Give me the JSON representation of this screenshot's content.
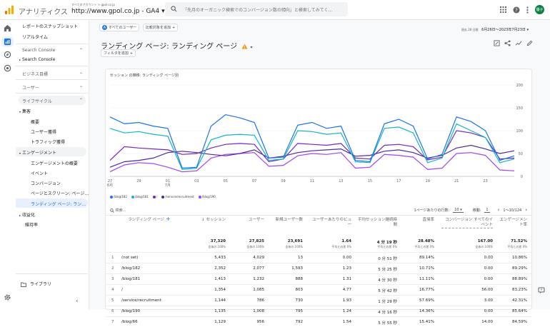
{
  "topbar": {
    "app_title": "アナリティクス",
    "account_path": "すべてのアカウント > gpol.co.jp",
    "property": "http://www.gpol.co.jp - GA4",
    "search_placeholder": "「先月のオーガニック検索でのコンバージョン数の傾向」と検索してみてく...",
    "avatar_initials": "優子"
  },
  "sidebar": {
    "snapshot": "レポートのスナップショット",
    "realtime": "リアルタイム",
    "search_console_section": "Search Console",
    "search_console_item": "Search Console",
    "business_goals": "ビジネス目標",
    "user": "ユーザー",
    "lifecycle": "ライフサイクル",
    "acquisition": "集客",
    "acq_overview": "概要",
    "acq_user": "ユーザー獲得",
    "acq_traffic": "トラフィック獲得",
    "engagement": "エンゲージメント",
    "eng_overview": "エンゲージメントの概要",
    "eng_events": "イベント",
    "eng_conversions": "コンバージョン",
    "eng_pages": "ページとスクリーン: ページ...",
    "eng_landing": "ランディング ページ: ラン...",
    "monetization": "収益化",
    "retention": "維持率",
    "library": "ライブラリ"
  },
  "filters": {
    "all_users": "すべてのユーザー",
    "add_comparison": "比較対象を追加",
    "add_filter": "フィルタを追加",
    "date_label": "過去 28 日間",
    "date_range": "6月26日～2023年7月23日"
  },
  "page": {
    "title": "ランディング ページ: ランディング ページ"
  },
  "chart_title": "セッション の推移: ランディング ページ別",
  "chart_data": {
    "type": "line",
    "ylim": [
      0,
      200
    ],
    "yticks": [
      "0",
      "50",
      "100",
      "150",
      "200"
    ],
    "x_labels": [
      "27\n6月",
      "29",
      "01\n7月",
      "03",
      "05",
      "07",
      "09",
      "11",
      "13",
      "15",
      "17",
      "19",
      "21",
      "23"
    ],
    "series": [
      {
        "name": "/blog/182",
        "color": "#1a73e8",
        "values": [
          130,
          115,
          118,
          110,
          105,
          18,
          20,
          110,
          135,
          128,
          118,
          40,
          42,
          112,
          118,
          105,
          110,
          35,
          32,
          115,
          125,
          110,
          38,
          48,
          130,
          120,
          100,
          35,
          45
        ]
      },
      {
        "name": "/blog/181",
        "color": "#12b5cb",
        "values": [
          105,
          95,
          98,
          92,
          88,
          15,
          18,
          80,
          90,
          92,
          90,
          35,
          38,
          100,
          98,
          92,
          95,
          32,
          30,
          105,
          108,
          95,
          30,
          40,
          115,
          100,
          85,
          30,
          38
        ]
      },
      {
        "name": "/",
        "color": "#7627bb",
        "values": [
          35,
          65,
          62,
          60,
          58,
          48,
          50,
          62,
          70,
          72,
          70,
          32,
          38,
          72,
          70,
          68,
          72,
          40,
          38,
          68,
          70,
          65,
          36,
          42,
          100,
          95,
          85,
          38,
          40
        ]
      },
      {
        "name": "/service/recruitment",
        "color": "#4b2a9f",
        "values": [
          20,
          32,
          35,
          40,
          52,
          55,
          52,
          48,
          45,
          50,
          58,
          40,
          44,
          52,
          56,
          58,
          60,
          44,
          46,
          55,
          58,
          52,
          40,
          46,
          62,
          68,
          60,
          50,
          56
        ]
      },
      {
        "name": "/blog/190",
        "color": "#a142f4",
        "values": [
          10,
          25,
          30,
          28,
          20,
          10,
          12,
          40,
          48,
          50,
          52,
          22,
          24,
          45,
          50,
          48,
          52,
          18,
          20,
          48,
          46,
          42,
          15,
          18,
          50,
          52,
          46,
          14,
          12
        ]
      }
    ]
  },
  "table": {
    "search_placeholder": "検索...",
    "rows_per_page_label": "1ページあたりの行数:",
    "rows_per_page": "10",
    "goto_label": "移動:",
    "goto_value": "1",
    "range": "1〜10/124",
    "headers": {
      "page": "ランディング ページ",
      "sessions": "↓ セッション",
      "users": "ユーザー",
      "new_users": "新規ユーザー数",
      "sessions_per_user": "ユーザーあたりのビュー",
      "avg_engagement": "平均セッション継続時間",
      "bounce": "直帰率",
      "conversions": "コンバージョン すべてのイベント",
      "engagement_rate": "エンゲージメント率"
    },
    "totals": {
      "sessions": "37,320",
      "sessions_sub": "全体の 100%",
      "users": "27,825",
      "users_sub": "全体の 100%",
      "new_users": "23,691",
      "new_users_sub": "全体の 100%",
      "spu": "1.64",
      "spu_sub": "平均との差 0%",
      "avg": "4 分 19 秒",
      "avg_sub": "平均との差 0%",
      "bounce": "28.48%",
      "bounce_sub": "平均との差 0%",
      "conv": "167.00",
      "conv_sub": "全体の 100%",
      "eng": "71.52%",
      "eng_sub": "平均との差 0%"
    },
    "rows": [
      {
        "n": "1",
        "page": "(not set)",
        "sessions": "5,433",
        "users": "4,029",
        "new": "13",
        "spu": "0.00",
        "avg": "0 分 51 秒",
        "bounce": "89.14%",
        "conv": "0.00",
        "eng": "10.86%"
      },
      {
        "n": "2",
        "page": "/blog/182",
        "sessions": "2,352",
        "users": "2,077",
        "new": "1,593",
        "spu": "1.23",
        "avg": "5 分 25 秒",
        "bounce": "10.71%",
        "conv": "0.00",
        "eng": "89.29%"
      },
      {
        "n": "3",
        "page": "/blog/181",
        "sessions": "1,413",
        "users": "1,232",
        "new": "888",
        "spu": "1.31",
        "avg": "4 分 30 秒",
        "bounce": "11.11%",
        "conv": "0.00",
        "eng": "88.89%"
      },
      {
        "n": "4",
        "page": "/",
        "sessions": "1,354",
        "users": "1,085",
        "new": "803",
        "spu": "4.77",
        "avg": "5 分 42 秒",
        "bounce": "16.77%",
        "conv": "56.00",
        "eng": "83.23%"
      },
      {
        "n": "5",
        "page": "/service/recruitment",
        "sessions": "1,144",
        "users": "786",
        "new": "730",
        "spu": "1.93",
        "avg": "1 分 29 秒",
        "bounce": "57.69%",
        "conv": "3.00",
        "eng": "42.31%"
      },
      {
        "n": "6",
        "page": "/blog/190",
        "sessions": "1,135",
        "users": "1,008",
        "new": "795",
        "spu": "1.24",
        "avg": "4 分 16 秒",
        "bounce": "14.36%",
        "conv": "0.00",
        "eng": "85.64%"
      },
      {
        "n": "7",
        "page": "/blog/66",
        "sessions": "1,129",
        "users": "956",
        "new": "792",
        "spu": "1.54",
        "avg": "5 分 55 秒",
        "bounce": "15.41%",
        "conv": "14.00",
        "eng": "84.59%"
      }
    ]
  },
  "colors": {
    "accent": "#1a73e8",
    "warning": "#f29900",
    "logo1": "#f9ab00",
    "logo2": "#e37400"
  }
}
